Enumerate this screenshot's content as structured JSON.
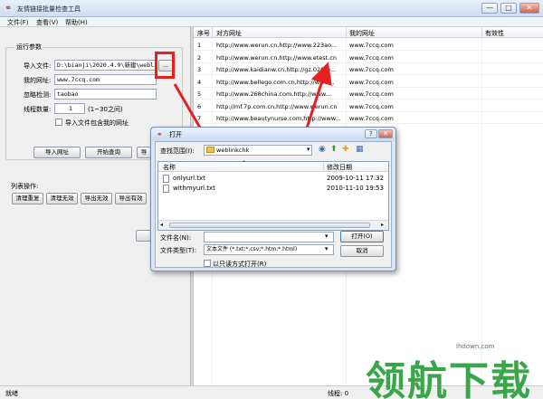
{
  "window": {
    "title": "友情链接批量检查工具",
    "icon": "link-icon",
    "controls": {
      "minimize": "—",
      "maximize": "□",
      "close": "✕"
    }
  },
  "menu": {
    "items": [
      "文件(F)",
      "查看(V)",
      "帮助(H)"
    ]
  },
  "params": {
    "group_title": "运行参数",
    "import_file_label": "导入文件:",
    "import_file_value": "D:\\bianji\\2020.4.9\\新建\\weblinkchk",
    "browse_label": "...",
    "my_url_label": "我的网址:",
    "my_url_value": "www.7ccq.com",
    "ignore_label": "忽略检测:",
    "ignore_value": "taobao",
    "threads_label": "线程数量:",
    "threads_value": "1",
    "threads_hint": "(1~30之间)",
    "include_mine_label": "导入文件包含我的网址"
  },
  "actions": {
    "import_url": "导入网址",
    "start_query": "开始查询",
    "third": "导"
  },
  "list_ops": {
    "title": "列表操作:",
    "clear_all": "清理重复",
    "clear_invalid": "清理无效",
    "export_invalid": "导出无效",
    "export_valid": "导出有效"
  },
  "table": {
    "headers": [
      "序号",
      "对方网址",
      "我的网址",
      "有效性"
    ],
    "rows": [
      [
        "1",
        "http://www.werun.cn,http://www.223ao...",
        "www.7ccq.com",
        ""
      ],
      [
        "2",
        "http://www.werun.cn,http://www.etest.cn",
        "www.7ccq.com",
        ""
      ],
      [
        "3",
        "http://www.kaidianw.cn,http://gz.020tp...",
        "www.7ccq.com",
        ""
      ],
      [
        "4",
        "http://www.bellego.com.cn,http://www...",
        "www.7ccq.com",
        ""
      ],
      [
        "5",
        "http://www.268china.com,http://www...",
        "www.7ccq.com",
        ""
      ],
      [
        "6",
        "http://mf.7p.com.cn,http://www.werun.cn",
        "www.7ccq.com",
        ""
      ],
      [
        "7",
        "http://www.beautynurse.com,http://www...",
        "www.7ccq.com",
        ""
      ]
    ]
  },
  "status": {
    "left": "就绪",
    "threads": "线程: 0",
    "right": "0"
  },
  "dialog": {
    "title": "打开",
    "lookin_label": "查找范围(I):",
    "lookin_value": "weblinkchk",
    "col_name": "名称",
    "col_modified": "修改日期",
    "files": [
      {
        "name": "onlyurl.txt",
        "date": "2009-10-11 17:32"
      },
      {
        "name": "withmyurl.txt",
        "date": "2010-11-10 19:53"
      }
    ],
    "filename_label": "文件名(N):",
    "filename_value": "",
    "filetype_label": "文件类型(T):",
    "filetype_value": "文本文件 (*.txt;*.csv;*.htm;*.html)",
    "readonly_label": "以只读方式打开(R)",
    "open_button": "打开(O)",
    "cancel_button": "取消"
  },
  "watermark": {
    "text": "领航下载",
    "url": "lhdown.com"
  },
  "colors": {
    "highlight_red": "#e8201e",
    "watermark_green": "#3aa64a"
  }
}
